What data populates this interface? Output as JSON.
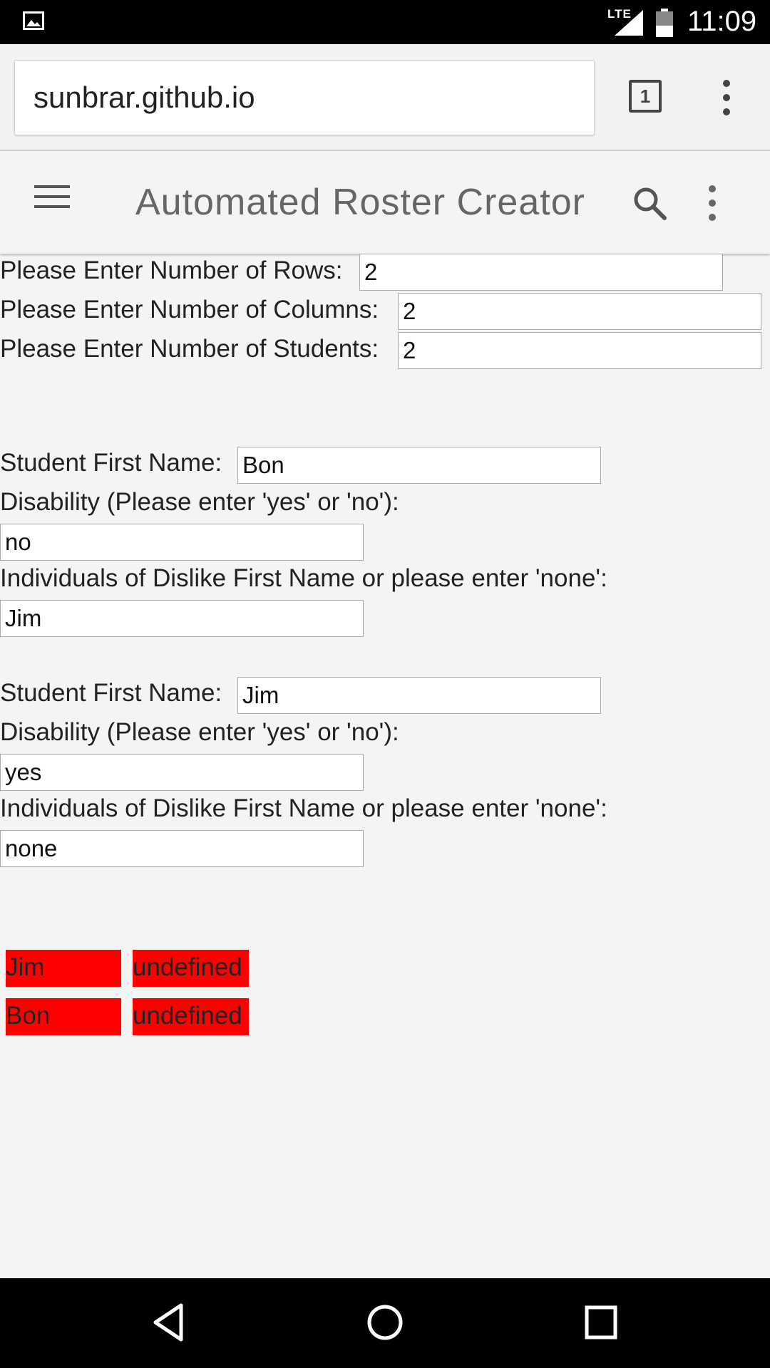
{
  "status_bar": {
    "network": "LTE",
    "time": "11:09",
    "icons": [
      "gallery-icon",
      "signal-icon",
      "battery-icon"
    ]
  },
  "browser": {
    "url": "sunbrar.github.io",
    "tab_count": "1"
  },
  "app": {
    "title": "Automated Roster Creator"
  },
  "setup": {
    "rows_label": "Please Enter Number of Rows:",
    "rows_value": "2",
    "columns_label": "Please Enter Number of Columns:",
    "columns_value": "2",
    "students_label": "Please Enter Number of Students:",
    "students_value": "2"
  },
  "students": [
    {
      "name_label": "Student First Name:",
      "name_value": "Bon",
      "disability_label": "Disability (Please enter 'yes' or 'no'):",
      "disability_value": "no",
      "dislike_label": "Individuals of Dislike First Name or please enter 'none':",
      "dislike_value": "Jim"
    },
    {
      "name_label": "Student First Name:",
      "name_value": "Jim",
      "disability_label": "Disability (Please enter 'yes' or 'no'):",
      "disability_value": "yes",
      "dislike_label": "Individuals of Dislike First Name or please enter 'none':",
      "dislike_value": "none"
    }
  ],
  "roster": {
    "cell_color": "#ff0000",
    "rows": [
      [
        "Jim",
        "undefined"
      ],
      [
        "Bon",
        "undefined"
      ]
    ]
  },
  "nav": {
    "icons": [
      "back-icon",
      "home-icon",
      "recents-icon"
    ]
  }
}
